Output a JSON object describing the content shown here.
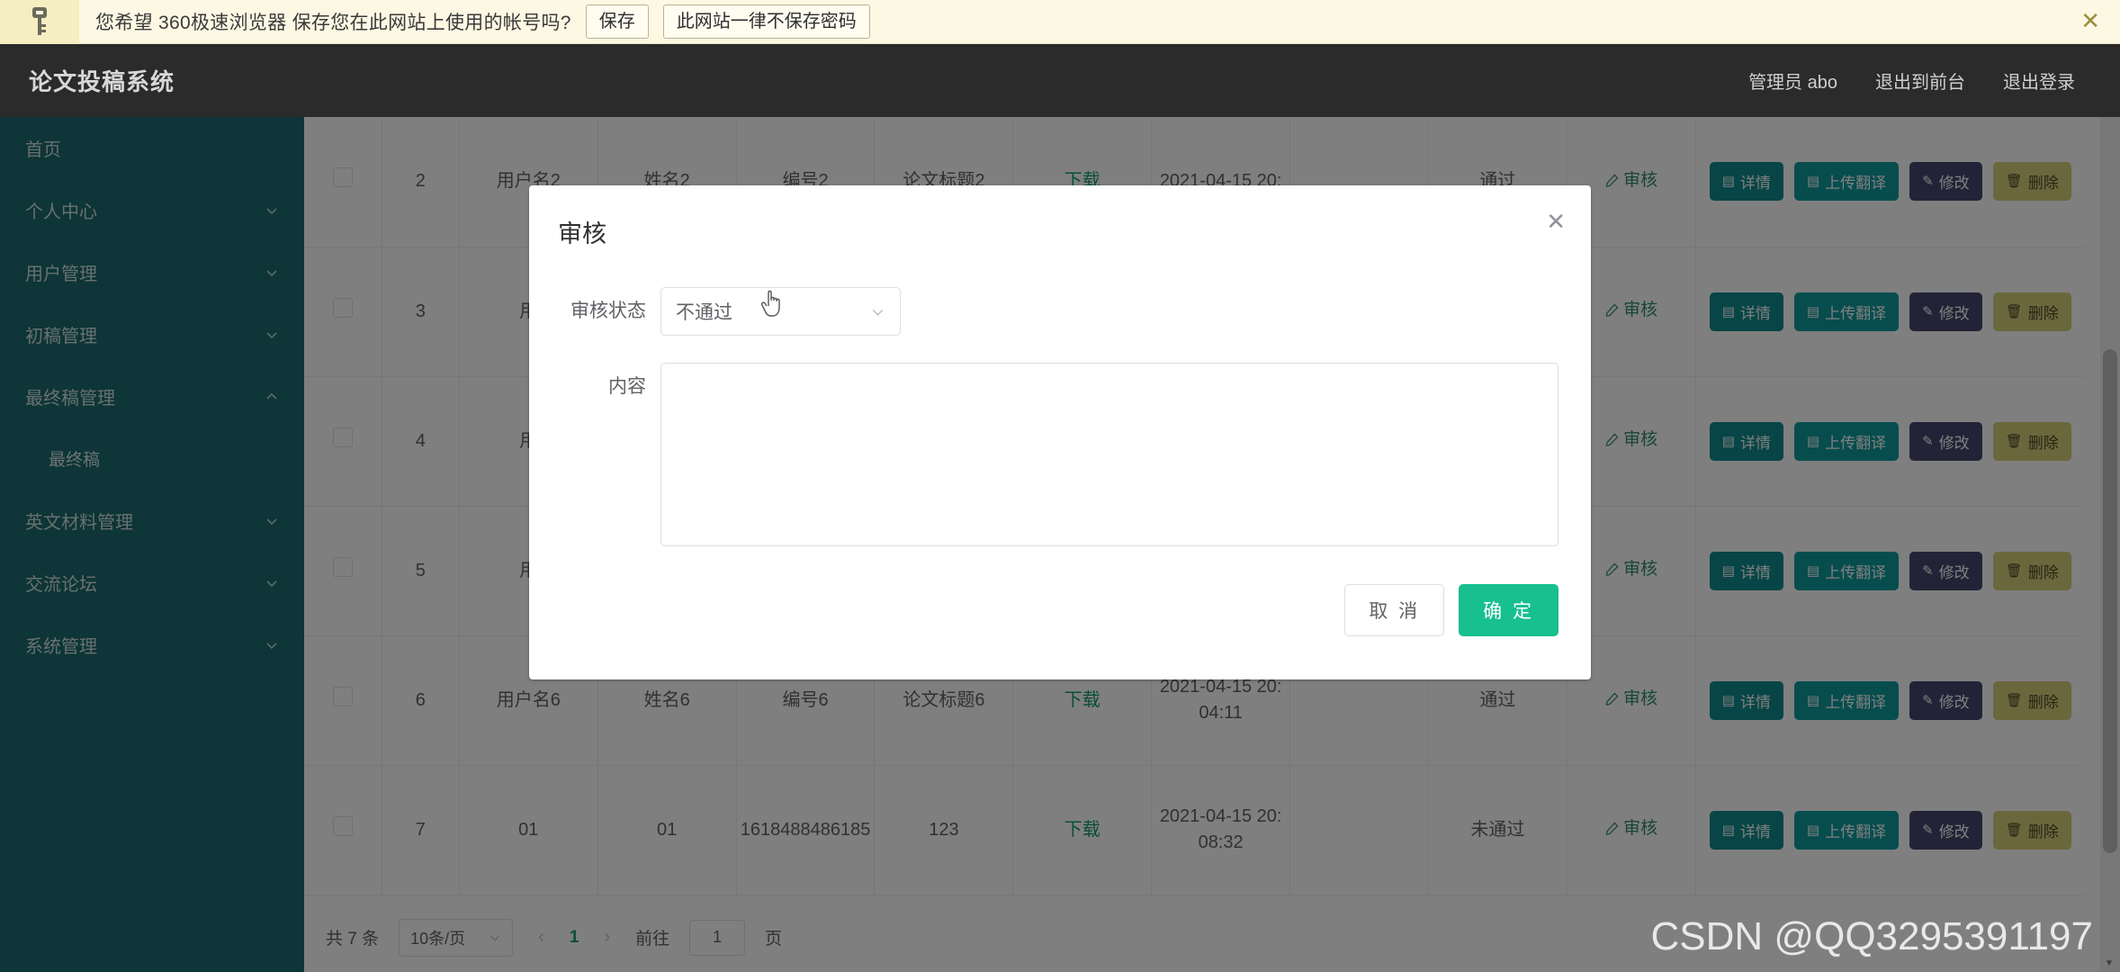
{
  "notification": {
    "icon": "key-icon",
    "message": "您希望 360极速浏览器 保存您在此网站上使用的帐号吗?",
    "save_label": "保存",
    "never_label": "此网站一律不保存密码",
    "close_icon": "close-icon"
  },
  "header": {
    "brand": "论文投稿系统",
    "links": [
      "管理员 abo",
      "退出到前台",
      "退出登录"
    ]
  },
  "sidebar": {
    "items": [
      {
        "label": "首页",
        "expandable": false,
        "expanded": false,
        "sub": false
      },
      {
        "label": "个人中心",
        "expandable": true,
        "expanded": false,
        "sub": false
      },
      {
        "label": "用户管理",
        "expandable": true,
        "expanded": false,
        "sub": false
      },
      {
        "label": "初稿管理",
        "expandable": true,
        "expanded": false,
        "sub": false
      },
      {
        "label": "最终稿管理",
        "expandable": true,
        "expanded": true,
        "sub": false
      },
      {
        "label": "最终稿",
        "expandable": false,
        "expanded": false,
        "sub": true
      },
      {
        "label": "英文材料管理",
        "expandable": true,
        "expanded": false,
        "sub": false
      },
      {
        "label": "交流论坛",
        "expandable": true,
        "expanded": false,
        "sub": false
      },
      {
        "label": "系统管理",
        "expandable": true,
        "expanded": false,
        "sub": false
      }
    ]
  },
  "table": {
    "rows": [
      {
        "index": "2",
        "username": "用户名2",
        "name": "姓名2",
        "number": "编号2",
        "title": "论文标题2",
        "download": "下载",
        "time": "2021-04-15 20:",
        "time2": "",
        "blank": "",
        "state": "通过",
        "review": "审核"
      },
      {
        "index": "3",
        "username": "用",
        "name": "",
        "number": "",
        "title": "",
        "download": "",
        "time": "",
        "time2": "",
        "blank": "",
        "state": "",
        "review": "审核"
      },
      {
        "index": "4",
        "username": "用",
        "name": "",
        "number": "",
        "title": "",
        "download": "",
        "time": "",
        "time2": "",
        "blank": "",
        "state": "",
        "review": "审核"
      },
      {
        "index": "5",
        "username": "用",
        "name": "",
        "number": "",
        "title": "",
        "download": "",
        "time": "",
        "time2": "",
        "blank": "",
        "state": "",
        "review": "审核"
      },
      {
        "index": "6",
        "username": "用户名6",
        "name": "姓名6",
        "number": "编号6",
        "title": "论文标题6",
        "download": "下载",
        "time": "2021-04-15 20:",
        "time2": "04:11",
        "blank": "",
        "state": "通过",
        "review": "审核"
      },
      {
        "index": "7",
        "username": "01",
        "name": "01",
        "number": "161848848618",
        "number2": "5",
        "title": "123",
        "download": "下载",
        "time": "2021-04-15 20:",
        "time2": "08:32",
        "blank": "",
        "state": "未通过",
        "review": "审核"
      }
    ],
    "ops": {
      "detail": "详情",
      "upload": "上传翻译",
      "edit": "修改",
      "delete": "删除"
    }
  },
  "pagination": {
    "total_label": "共 7 条",
    "page_size": "10条/页",
    "prev_icon": "chevron-left-icon",
    "next_icon": "chevron-right-icon",
    "current_page": "1",
    "goto_label": "前往",
    "goto_value": "1",
    "page_unit": "页"
  },
  "modal": {
    "title": "审核",
    "close_icon": "close-icon",
    "status_label": "审核状态",
    "status_value": "不通过",
    "content_label": "内容",
    "content_value": "",
    "cancel_label": "取 消",
    "confirm_label": "确 定"
  },
  "watermark": "CSDN @QQ3295391197",
  "colors": {
    "sidebar": "#1d6b6f",
    "header": "#2b2b2b",
    "accent_green": "#18c08f",
    "link_green": "#13a06a",
    "notif_bg": "#fcf8e3",
    "btn_detail": "#0f8a8d",
    "btn_upload": "#0f9a9c",
    "btn_edit": "#46466e",
    "btn_delete": "#d6cf7a"
  }
}
